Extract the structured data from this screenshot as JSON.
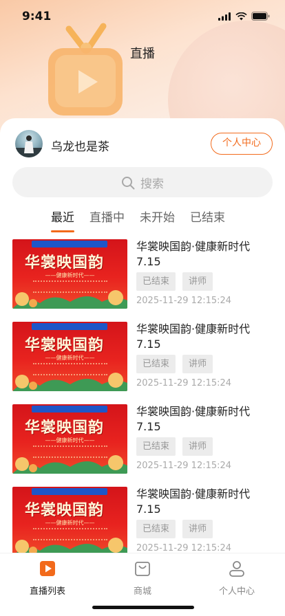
{
  "status": {
    "time": "9:41"
  },
  "header": {
    "title": "直播"
  },
  "profile": {
    "name": "乌龙也是茶",
    "center_button": "个人中心"
  },
  "search": {
    "placeholder": "搜索"
  },
  "tabs": [
    {
      "label": "最近",
      "active": true
    },
    {
      "label": "直播中",
      "active": false
    },
    {
      "label": "未开始",
      "active": false
    },
    {
      "label": "已结束",
      "active": false
    }
  ],
  "items": [
    {
      "title": "华裳映国韵·健康新时代7.15",
      "status": "已结束",
      "role": "讲师",
      "time": "2025-11-29 12:15:24",
      "thumb_title": "华裳映国韵",
      "thumb_sub": "——健康新时代——"
    },
    {
      "title": "华裳映国韵·健康新时代7.15",
      "status": "已结束",
      "role": "讲师",
      "time": "2025-11-29 12:15:24",
      "thumb_title": "华裳映国韵",
      "thumb_sub": "——健康新时代——"
    },
    {
      "title": "华裳映国韵·健康新时代7.15",
      "status": "已结束",
      "role": "讲师",
      "time": "2025-11-29 12:15:24",
      "thumb_title": "华裳映国韵",
      "thumb_sub": "——健康新时代——"
    },
    {
      "title": "华裳映国韵·健康新时代7.15",
      "status": "已结束",
      "role": "讲师",
      "time": "2025-11-29 12:15:24",
      "thumb_title": "华裳映国韵",
      "thumb_sub": "——健康新时代——"
    }
  ],
  "tabbar": [
    {
      "label": "直播列表",
      "icon": "live-play-icon",
      "active": true
    },
    {
      "label": "商城",
      "icon": "shopping-bag-icon",
      "active": false
    },
    {
      "label": "个人中心",
      "icon": "person-icon",
      "active": false
    }
  ],
  "colors": {
    "accent": "#f26a1b",
    "background": "#ffffff",
    "tag_bg": "#ececec"
  }
}
